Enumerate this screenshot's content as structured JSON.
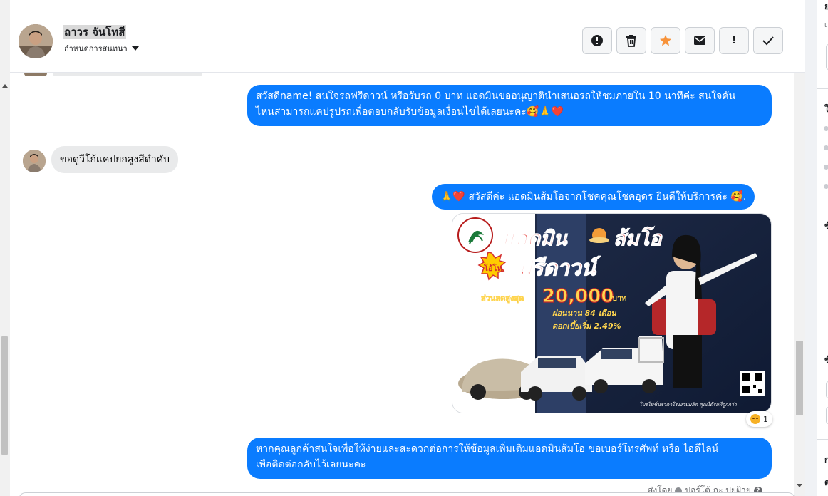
{
  "header": {
    "contact_name": "ถาวร จันโทสี",
    "assign_label": "กำหนดการสนทนา"
  },
  "actions": [
    {
      "name": "report-spam",
      "icon": "alert-circle-icon"
    },
    {
      "name": "delete",
      "icon": "trash-icon"
    },
    {
      "name": "star",
      "icon": "star-icon",
      "color": "#f7923a"
    },
    {
      "name": "mark-unread",
      "icon": "envelope-icon"
    },
    {
      "name": "flag-important",
      "icon": "exclamation-icon",
      "label": "!"
    },
    {
      "name": "mark-done",
      "icon": "checkmark-icon"
    }
  ],
  "messages": [
    {
      "direction": "outgoing",
      "lines": [
        "สวัสดีname! สนใจรถฟรีดาวน์ หรือรับรถ 0 บาท แอดมินขออนุญาตินำเสนอรถให้ชมภายใน 10 นาทีค่ะ สนใจคัน",
        "ไหนสามารถแคปรูปรถเพื่อตอบกลับรับข้อมูลเงื่อนไขได้เลยนะคะ🥰🙏❤️"
      ]
    },
    {
      "direction": "incoming",
      "text": "ขอดูวีโก้แคปยกสูงสีดำคับ"
    },
    {
      "direction": "outgoing",
      "text": "🙏❤️ สวัสดีค่ะ แอดมินส้มโอจากโชคคุณโชคอุดร ยินดีให้บริการค่ะ 🥰."
    },
    {
      "direction": "outgoing",
      "type": "image-card",
      "ad": {
        "title": "แอดมิน",
        "title2": "ส้มโอ",
        "badge": "โอ้โห",
        "headline": "ฟรีดาวน์",
        "discount_label": "ส่วนลดสูงสุด",
        "discount_value": "20,000",
        "discount_unit": "บาท",
        "installment": "ผ่อนนาน 84 เดือน",
        "interest": "ดอกเบี้ยเริ่ม 2.49%",
        "footer": "โปรโมชั่นราคาโรงงานผลิต คุณได้รถที่ถูกกว่า"
      },
      "reaction": {
        "emoji": "angry-face",
        "count": "1"
      }
    },
    {
      "direction": "outgoing",
      "lines": [
        "หากคุณลูกค้าสนใจเพื่อให้ง่ายและสะดวกต่อการให้ข้อมูลเพิ่มเติมแอดมินส้มโอ ขอเบอร์โทรศัพท์ หรือ ไอดีไลน์",
        "เพื่อติดต่อกลับไว้เลยนะคะ"
      ]
    }
  ],
  "sent_by": {
    "prefix": "ส่งโดย",
    "name": "ปอร์โต้ กะ ปุยฝ้าย",
    "help": "?"
  },
  "right_panel": {
    "glyphs": [
      "ย",
      "เ",
      "ใ",
      "ข้",
      "ข้",
      "ก",
      "ต"
    ]
  },
  "colors": {
    "outgoing_bubble": "#0a7cff",
    "incoming_bubble": "#e9eaeb",
    "star_accent": "#f7923a"
  }
}
